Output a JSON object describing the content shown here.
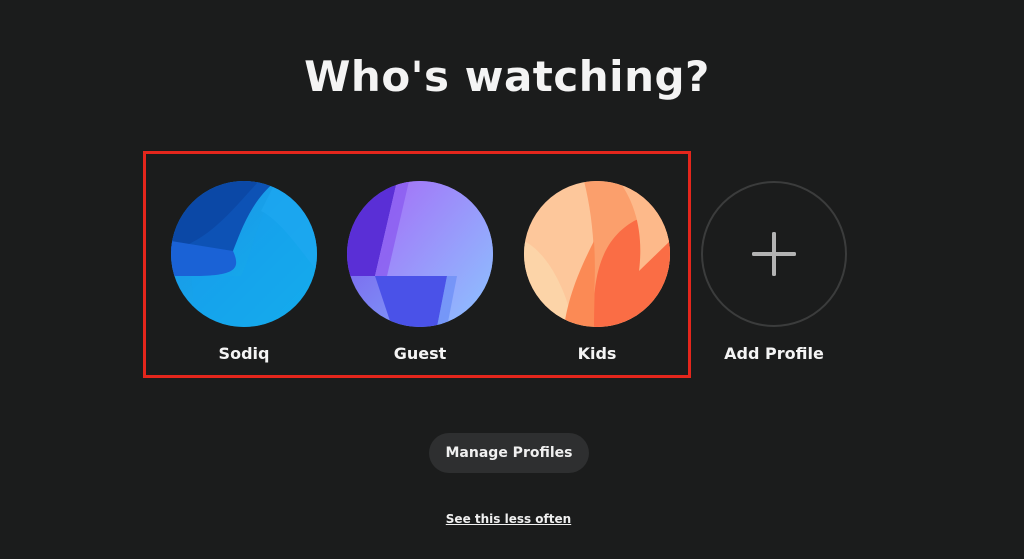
{
  "page": {
    "title": "Who's watching?"
  },
  "profiles": [
    {
      "name": "Sodiq",
      "avatar": "blue-abstract-avatar"
    },
    {
      "name": "Guest",
      "avatar": "purple-lightning-avatar"
    },
    {
      "name": "Kids",
      "avatar": "orange-leaf-avatar"
    }
  ],
  "add_profile": {
    "label": "Add Profile",
    "icon": "plus-icon"
  },
  "actions": {
    "manage_label": "Manage Profiles",
    "see_less_label": "See this less often"
  },
  "colors": {
    "background": "#1b1c1c",
    "highlight_border": "#e4261c",
    "button_background": "#2e2f30",
    "text": "#f4f4f4"
  }
}
